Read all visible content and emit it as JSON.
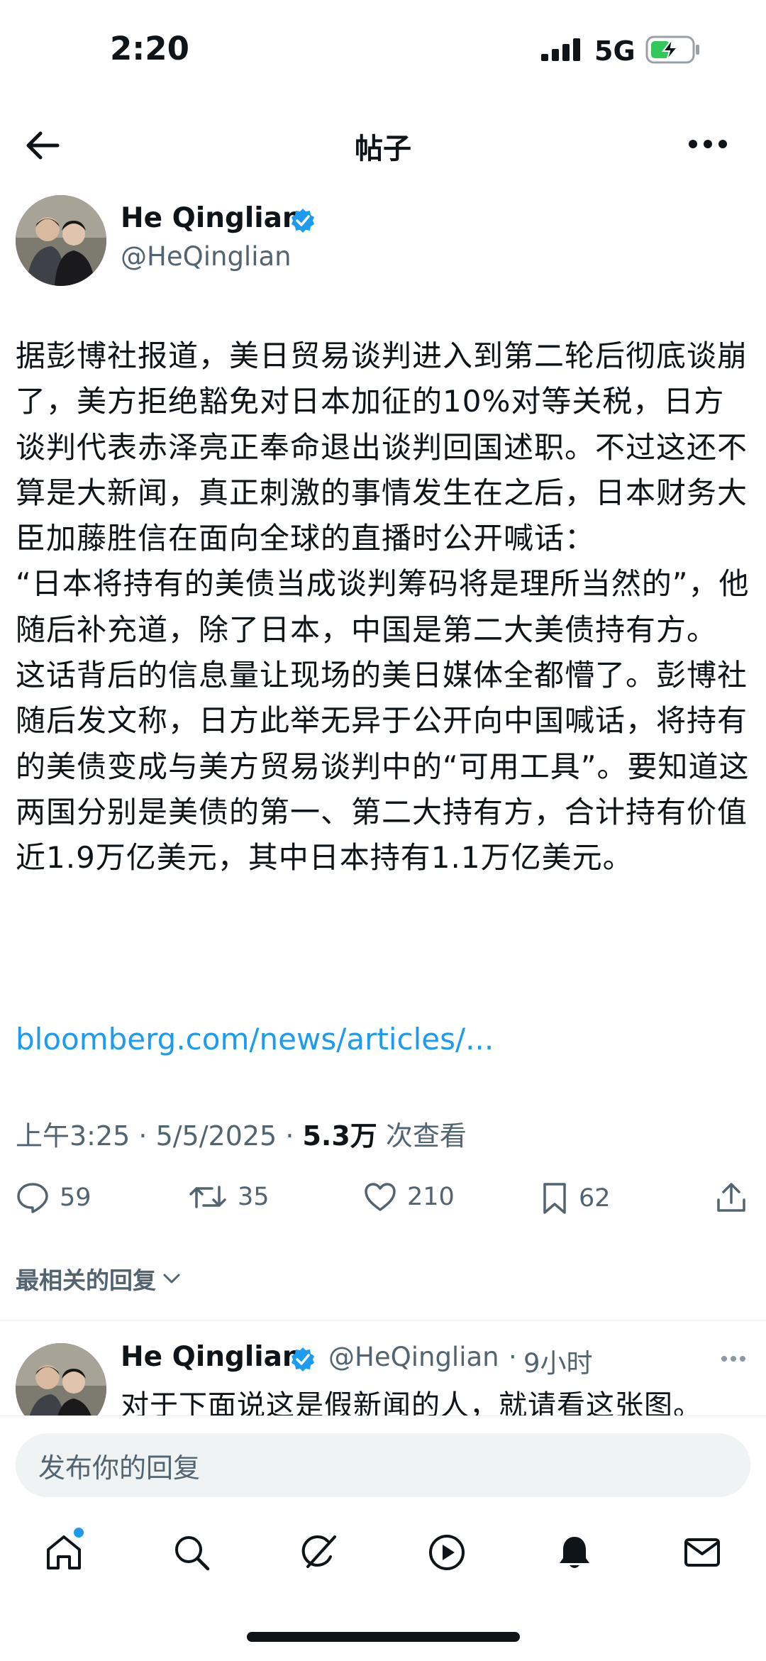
{
  "status_bar": {
    "time": "2:20",
    "network": "5G",
    "battery_color": "#34c759"
  },
  "header": {
    "title": "帖子",
    "back_icon": "arrow-left-icon",
    "more_icon": "more-horizontal-icon"
  },
  "post": {
    "author_name": "He Qinglian",
    "author_handle": "@HeQinglian",
    "verified_color": "#1d9bf0",
    "body": "据彭博社报道，美日贸易谈判进入到第二轮后彻底谈崩了，美方拒绝豁免对日本加征的10%对等关税，日方谈判代表赤泽亮正奉命退出谈判回国述职。不过这还不算是大新闻，真正刺激的事情发生在之后，日本财务大臣加藤胜信在面向全球的直播时公开喊话：\n“日本将持有的美债当成谈判筹码将是理所当然的”，他随后补充道，除了日本，中国是第二大美债持有方。\n这话背后的信息量让现场的美日媒体全都懵了。彭博社随后发文称，日方此举无异于公开向中国喊话，将持有的美债变成与美方贸易谈判中的“可用工具”。要知道这两国分别是美债的第一、第二大持有方，合计持有价值近1.9万亿美元，其中日本持有1.1万亿美元。",
    "link": "bloomberg.com/news/articles/...",
    "timestamp": "上午3:25 · 5/5/2025 · ",
    "views_count": "5.3万",
    "views_label": " 次查看"
  },
  "actions": {
    "replies": "59",
    "retweets": "35",
    "likes": "210",
    "bookmarks": "62"
  },
  "replies_sort_label": "最相关的回复",
  "reply": {
    "author_name": "He Qinglian",
    "author_handle": "@HeQinglian",
    "separator": "·",
    "time": "9小时",
    "text": "对于下面说这是假新闻的人，就请看这张图。"
  },
  "compose": {
    "placeholder": "发布你的回复"
  },
  "nav": {
    "items": [
      "home-icon",
      "search-icon",
      "grok-icon",
      "video-icon",
      "notifications-icon",
      "messages-icon"
    ],
    "accent": "#1d9bf0"
  }
}
